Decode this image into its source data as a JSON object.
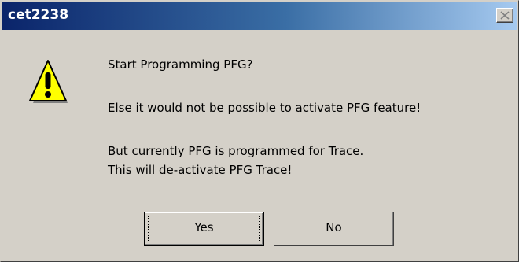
{
  "window": {
    "title": "cet2238",
    "close_icon": "close-icon"
  },
  "icon": {
    "type": "warning-icon",
    "color": "#ffff00"
  },
  "message": {
    "line1": "Start Programming PFG?",
    "line2": "Else it would not be possible to activate PFG feature!",
    "line3": "But currently PFG is programmed for Trace.",
    "line4": "This will de-activate PFG Trace!"
  },
  "buttons": {
    "yes_label": "Yes",
    "no_label": "No"
  },
  "colors": {
    "titlebar_start": "#0a246a",
    "titlebar_end": "#a6caf0",
    "dialog_face": "#d4d0c8"
  }
}
